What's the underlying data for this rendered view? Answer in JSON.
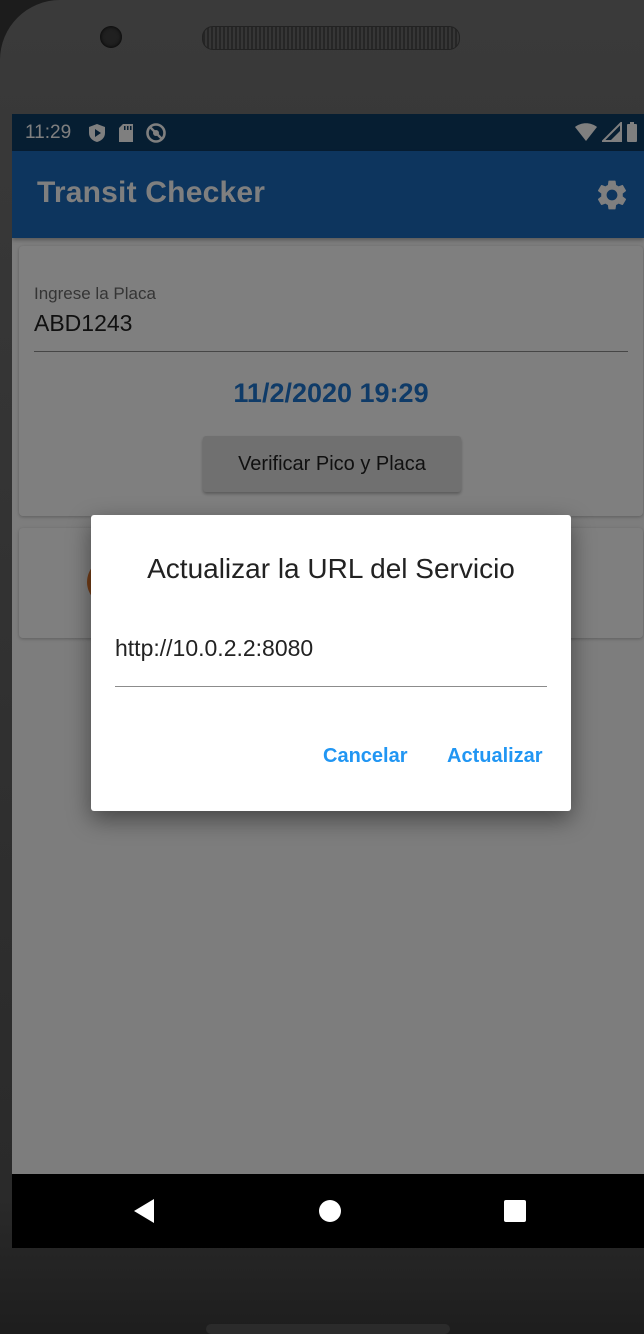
{
  "statusbar": {
    "time": "11:29"
  },
  "appbar": {
    "title": "Transit Checker"
  },
  "plate_card": {
    "label": "Ingrese la Placa",
    "value": "ABD1243",
    "datetime": "11/2/2020 19:29",
    "verify_label": "Verificar Pico y Placa"
  },
  "dialog": {
    "title": "Actualizar la URL del Servicio",
    "url_value": "http://10.0.2.2:8080",
    "cancel_label": "Cancelar",
    "update_label": "Actualizar"
  },
  "colors": {
    "statusbar": "#0d3c65",
    "appbar": "#1a6bbd",
    "accent": "#2196f3",
    "date_text": "#1f77d0",
    "fab": "#1e78d4",
    "avatar": "#e87a2e"
  },
  "icons": {
    "settings": "gear-icon",
    "fab": "delete-restore-icon",
    "nav_back": "back-triangle-icon",
    "nav_home": "home-circle-icon",
    "nav_recents": "recents-square-icon"
  }
}
